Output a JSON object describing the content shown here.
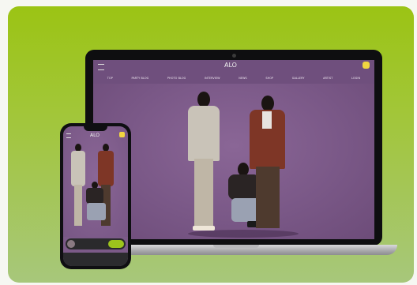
{
  "site": {
    "logo_text": "ALO",
    "nav": [
      "TOP",
      "PARTY BLOG",
      "PHOTO BLOG",
      "INTERVIEW",
      "NEWS",
      "SHOP",
      "GALLERY",
      "ARTIST",
      "LOGIN"
    ]
  },
  "phone": {
    "logo_text": "ALO",
    "player_line1": "",
    "player_line2": "",
    "player_button": ""
  },
  "colors": {
    "card_gradient_top": "#9bc414",
    "card_gradient_bottom": "#a7c77b",
    "site_background": "#7a5a86",
    "accent_badge": "#f1d640",
    "player_button": "#9dc41c"
  },
  "icons": [
    "hamburger-menu-icon",
    "profile-badge-icon",
    "camera-icon"
  ]
}
